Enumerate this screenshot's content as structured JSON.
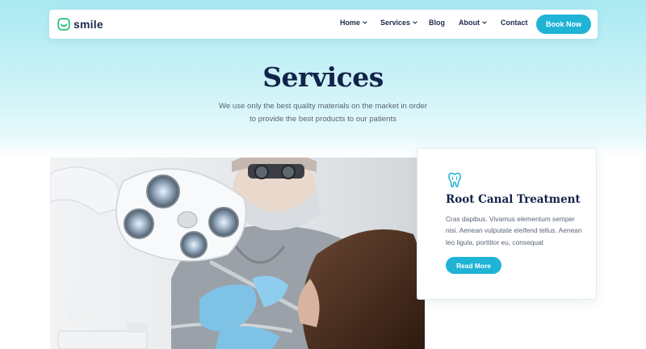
{
  "brand": {
    "name": "smile",
    "icon": "smile-icon",
    "accent": "#1fb3d6"
  },
  "nav": {
    "items": [
      {
        "label": "Home",
        "dropdown": true
      },
      {
        "label": "Services",
        "dropdown": true
      },
      {
        "label": "Blog",
        "dropdown": false
      },
      {
        "label": "About",
        "dropdown": true
      },
      {
        "label": "Contact",
        "dropdown": false
      }
    ],
    "cta": "Book Now"
  },
  "hero": {
    "title": "Services",
    "subtitle_line1": "We use only the best quality materials on the market in order",
    "subtitle_line2": "to provide the best products to our patients"
  },
  "service_card": {
    "icon": "tooth-icon",
    "title": "Root Canal Treatment",
    "text": "Cras dapibus. Vivamus elementum semper nisi. Aenean vulputate eleifend tellus. Aenean leo ligula, porttitor eu, consequat",
    "button": "Read More"
  },
  "photo": {
    "subject": "dental-procedure-photo"
  }
}
